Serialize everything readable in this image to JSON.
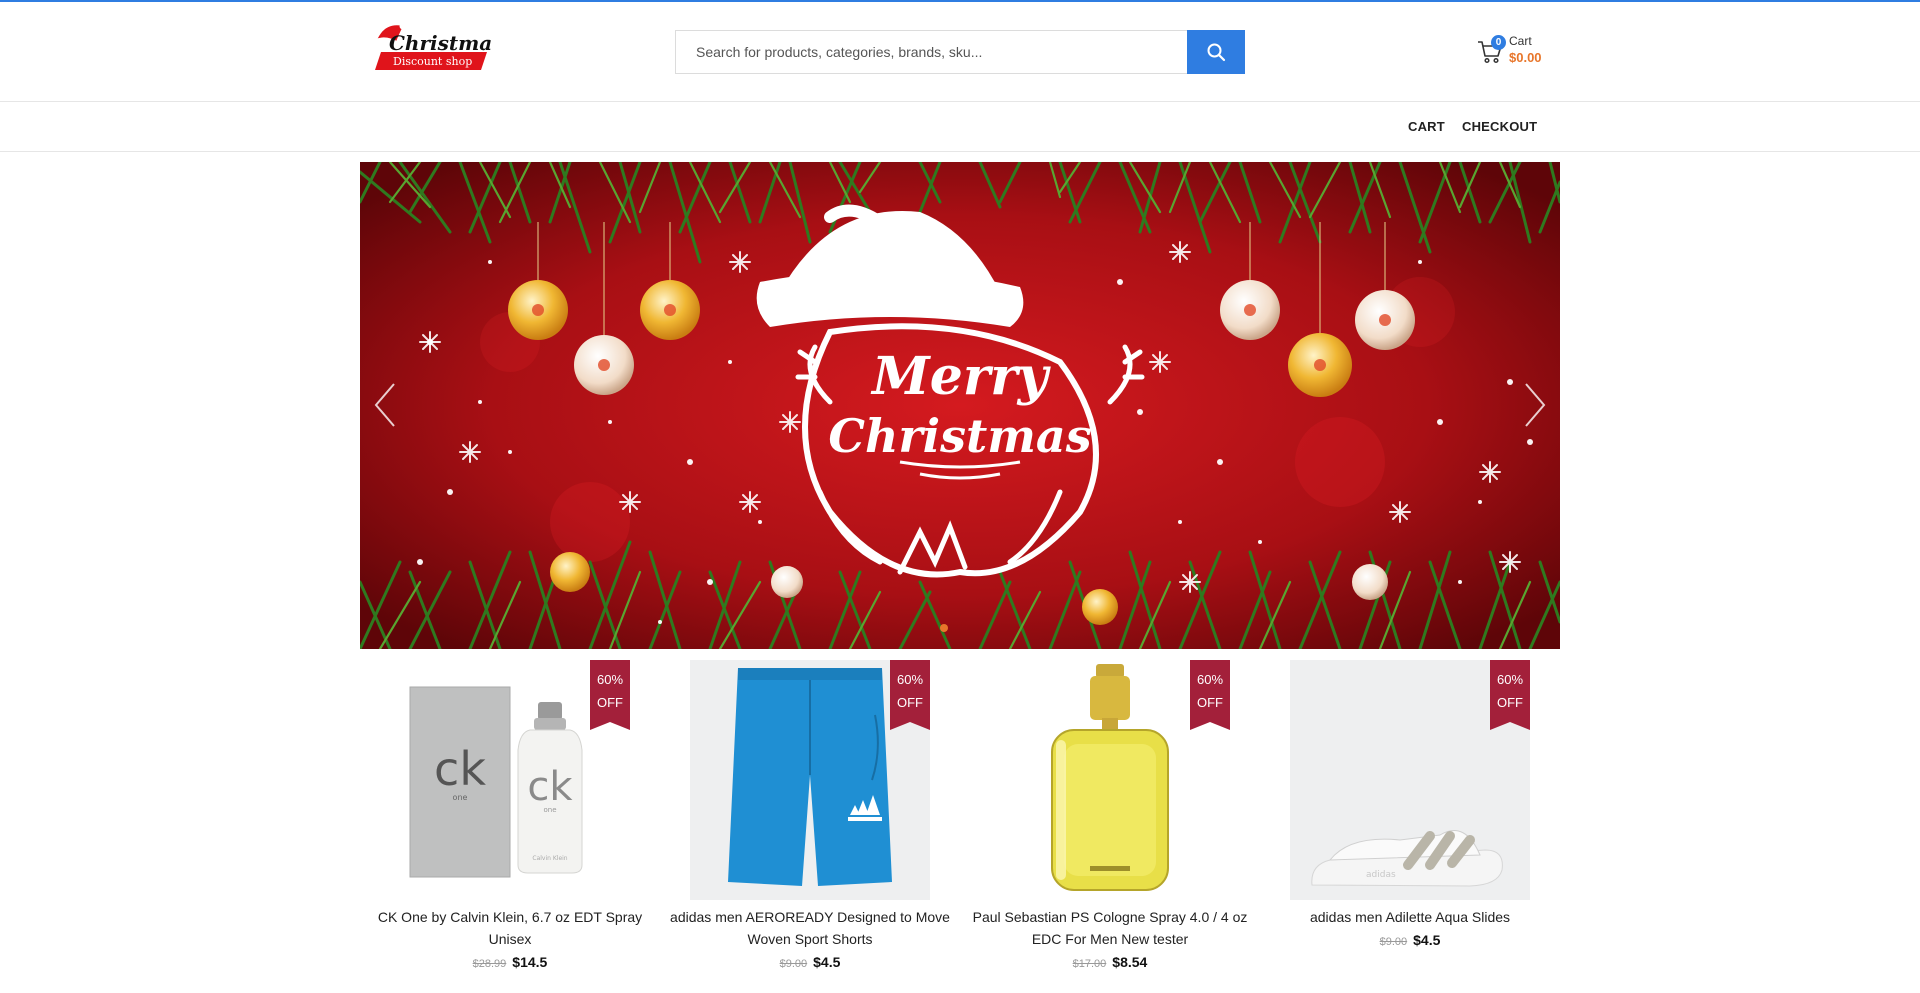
{
  "header": {
    "logo": {
      "line1": "Christmas",
      "line2": "Discount shop"
    },
    "search": {
      "placeholder": "Search for products, categories, brands, sku...",
      "value": ""
    },
    "cart": {
      "count": "0",
      "label": "Cart",
      "total": "$0.00"
    }
  },
  "nav": {
    "items": [
      {
        "label": "CART"
      },
      {
        "label": "CHECKOUT"
      }
    ]
  },
  "hero": {
    "text_line1": "Merry",
    "text_line2": "Christmas",
    "slide_count": 1,
    "active_slide": 1
  },
  "products": [
    {
      "name": "CK One by Calvin Klein, 6.7 oz EDT Spray Unisex",
      "old_price": "$28.99",
      "price": "$14.5",
      "badge_line1": "60%",
      "badge_line2": "OFF",
      "image_text": {
        "brand": "ck",
        "sub": "one",
        "maker": "Calvin Klein"
      }
    },
    {
      "name": "adidas men AEROREADY Designed to Move Woven Sport Shorts",
      "old_price": "$9.00",
      "price": "$4.5",
      "badge_line1": "60%",
      "badge_line2": "OFF",
      "image_text": {}
    },
    {
      "name": "Paul Sebastian PS Cologne Spray 4.0 / 4 oz EDC For Men New tester",
      "old_price": "$17.00",
      "price": "$8.54",
      "badge_line1": "60%",
      "badge_line2": "OFF",
      "image_text": {}
    },
    {
      "name": "adidas men Adilette Aqua Slides",
      "old_price": "$9.00",
      "price": "$4.5",
      "badge_line1": "60%",
      "badge_line2": "OFF",
      "image_text": {
        "slide_brand": "adidas"
      }
    }
  ],
  "colors": {
    "accent": "#2f7de1",
    "cart_total": "#e8762b",
    "badge": "#a3203a",
    "hero_red": "#b81218"
  }
}
